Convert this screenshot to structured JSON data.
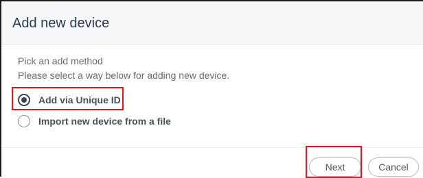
{
  "dialog": {
    "title": "Add new device",
    "subtitle": "Pick an add method",
    "hint": "Please select a way below for adding new device.",
    "options": [
      {
        "label": "Add via Unique ID",
        "selected": true
      },
      {
        "label": "Import new device from a file",
        "selected": false
      }
    ],
    "buttons": {
      "next_label": "Next",
      "cancel_label": "Cancel"
    }
  },
  "colors": {
    "header_bg": "#f6f7f9",
    "title_text": "#2b3a4f",
    "highlight": "#e8121b",
    "radio_checked": "#3a4552"
  }
}
